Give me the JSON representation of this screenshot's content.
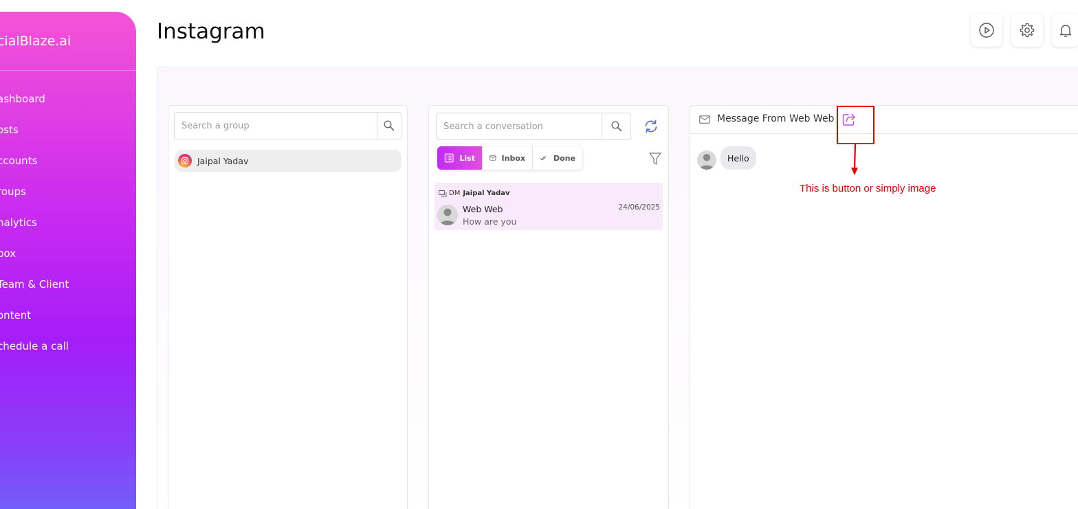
{
  "brand": {
    "name": "cialBlaze.ai"
  },
  "sidebar": {
    "items": [
      {
        "label": "ashboard"
      },
      {
        "label": "osts"
      },
      {
        "label": "ccounts"
      },
      {
        "label": "roups"
      },
      {
        "label": "nalytics"
      },
      {
        "label": "box"
      },
      {
        "label": "Team & Client"
      },
      {
        "label": "ontent"
      },
      {
        "label": "chedule a call"
      }
    ]
  },
  "header": {
    "title": "Instagram",
    "buttons": [
      {
        "icon": "play-circle-icon"
      },
      {
        "icon": "gear-icon"
      },
      {
        "icon": "bell-icon"
      }
    ]
  },
  "groups_panel": {
    "search_placeholder": "Search a group",
    "items": [
      {
        "name": "Jaipal Yadav",
        "platform": "instagram"
      }
    ]
  },
  "conversations_panel": {
    "search_placeholder": "Search a conversation",
    "tabs": [
      {
        "label": "List",
        "icon": "list-icon",
        "active": true
      },
      {
        "label": "Inbox",
        "icon": "mail-icon",
        "active": false
      },
      {
        "label": "Done",
        "icon": "double-check-icon",
        "active": false
      }
    ],
    "items": [
      {
        "type": "DM",
        "account": "Jaipal Yadav",
        "name": "Web Web",
        "preview": "How are you",
        "date": "24/06/2025"
      }
    ]
  },
  "message_panel": {
    "title": "Message From Web Web",
    "messages": [
      {
        "text": "Hello"
      }
    ]
  },
  "annotation": {
    "text": "This is button or simply image",
    "color": "#e00000"
  },
  "colors": {
    "accent": "#c02cf0",
    "sidebar_top": "#f553d6",
    "sidebar_bottom": "#6f63fb",
    "refresh": "#5a6cf0"
  }
}
